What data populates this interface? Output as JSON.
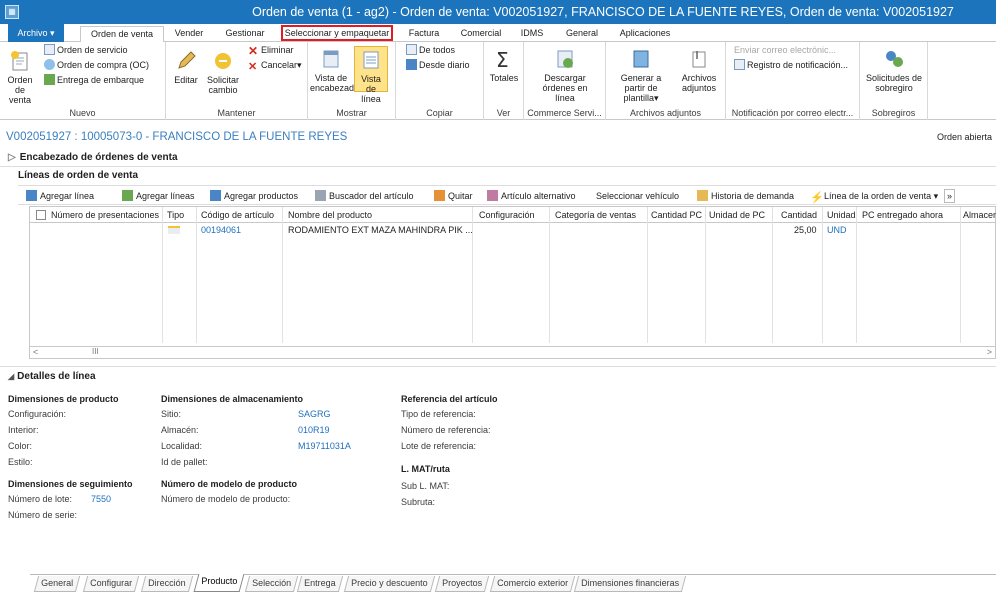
{
  "window": {
    "title": "Orden de venta (1 - ag2) - Orden de venta: V002051927, FRANCISCO DE LA FUENTE REYES, Orden de venta: V002051927"
  },
  "ribbon_tabs": [
    {
      "label": "Archivo ▾"
    },
    {
      "label": "Orden de venta"
    },
    {
      "label": "Vender"
    },
    {
      "label": "Gestionar"
    },
    {
      "label": "Seleccionar y empaquetar"
    },
    {
      "label": "Factura"
    },
    {
      "label": "Comercial"
    },
    {
      "label": "IDMS"
    },
    {
      "label": "General"
    },
    {
      "label": "Aplicaciones"
    }
  ],
  "ribbon": {
    "nuevo": {
      "group_label": "Nuevo",
      "big": "Orden de venta",
      "items": [
        "Orden de servicio",
        "Orden de compra (OC)",
        "Entrega de embarque"
      ]
    },
    "mantener": {
      "group_label": "Mantener",
      "editar": "Editar",
      "solicitar": "Solicitar cambio",
      "eliminar": "Eliminar",
      "cancelar": "Cancelar▾"
    },
    "mostrar": {
      "group_label": "Mostrar",
      "encabezado": "Vista de encabezado",
      "linea": "Vista de línea"
    },
    "copiar": {
      "group_label": "Copiar",
      "de_todos": "De todos",
      "desde_diario": "Desde diario"
    },
    "ver": {
      "group_label": "Ver",
      "totales": "Totales"
    },
    "commerce": {
      "group_label": "Commerce Servi...",
      "descargar": "Descargar órdenes en línea"
    },
    "adjuntos": {
      "group_label": "Archivos adjuntos",
      "generar": "Generar a partir de plantilla▾",
      "archivos": "Archivos adjuntos"
    },
    "notificacion": {
      "group_label": "Notificación por correo electr...",
      "enviar": "Enviar correo electrónic...",
      "registro": "Registro de notificación..."
    },
    "sobregiros": {
      "group_label": "Sobregiros",
      "solicitudes": "Solicitudes de sobregiro"
    }
  },
  "record": {
    "header": "V002051927 : 10005073-0 - FRANCISCO DE LA FUENTE REYES",
    "status": "Orden abierta"
  },
  "sections": {
    "encabezado": "Encabezado de órdenes de venta",
    "lineas": "Líneas de orden de venta",
    "detalles": "Detalles de línea"
  },
  "grid_toolbar": [
    {
      "label": "Agregar línea"
    },
    {
      "label": "Agregar líneas"
    },
    {
      "label": "Agregar productos"
    },
    {
      "label": "Buscador del artículo"
    },
    {
      "label": "Quitar"
    },
    {
      "label": "Artículo alternativo"
    },
    {
      "label": "Seleccionar vehículo"
    },
    {
      "label": "Historia de demanda"
    },
    {
      "label": "Línea de la orden de venta ▾"
    },
    {
      "label": "»"
    }
  ],
  "grid": {
    "columns": [
      "Número de presentaciones",
      "Tipo",
      "Código de artículo",
      "Nombre del producto",
      "Configuración",
      "Categoría de ventas",
      "Cantidad PC",
      "Unidad de PC",
      "Cantidad",
      "Unidad",
      "PC entregado ahora",
      "Almacen"
    ],
    "rows": [
      {
        "codigo": "00194061",
        "nombre": "RODAMIENTO EXT MAZA MAHINDRA PIK ...",
        "cantidad": "25,00",
        "unidad": "UND"
      }
    ],
    "scroll_mid": "III"
  },
  "details": {
    "prod_dims": {
      "title": "Dimensiones de producto",
      "labels": [
        "Configuración:",
        "Interior:",
        "Color:",
        "Estilo:"
      ]
    },
    "alm_dims": {
      "title": "Dimensiones de almacenamiento",
      "labels": [
        "Sitio:",
        "Almacén:",
        "Localidad:",
        "Id de pallet:"
      ],
      "values": [
        "SAGRG",
        "010R19",
        "M19711031A"
      ]
    },
    "ref": {
      "title": "Referencia del artículo",
      "labels": [
        "Tipo de referencia:",
        "Número de referencia:",
        "Lote de referencia:"
      ]
    },
    "seg_dims": {
      "title": "Dimensiones de seguimiento",
      "lote_label": "Número de lote:",
      "lote_value": "7550",
      "serie_label": "Número de serie:"
    },
    "modelo": {
      "title": "Número de modelo de producto",
      "label": "Número de modelo de producto:"
    },
    "lmat": {
      "title": "L. MAT/ruta",
      "labels": [
        "Sub L. MAT:",
        "Subruta:"
      ]
    }
  },
  "bottom_tabs": [
    "General",
    "Configurar",
    "Dirección",
    "Producto",
    "Selección",
    "Entrega",
    "Precio y descuento",
    "Proyectos",
    "Comercio exterior",
    "Dimensiones financieras"
  ],
  "colors": {
    "accent": "#1c75bc",
    "link": "#1f6fbf",
    "highlight": "#e01b24"
  }
}
